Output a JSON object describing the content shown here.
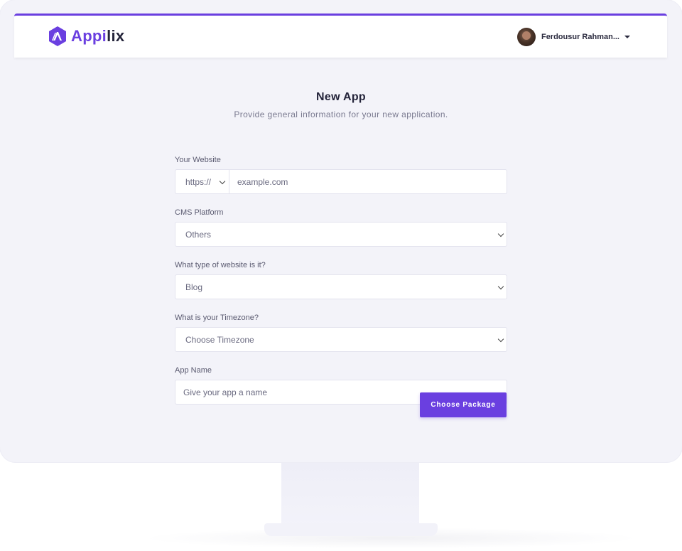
{
  "brand": {
    "name_part1": "Appi",
    "name_part2": "lix",
    "accent_color": "#6a3fe0"
  },
  "user": {
    "name": "Ferdousur Rahman...",
    "avatar_icon": "avatar-photo"
  },
  "page": {
    "title": "New App",
    "subtitle": "Provide general information for your new application."
  },
  "form": {
    "website": {
      "label": "Your Website",
      "protocol_value": "https://",
      "url_placeholder": "example.com"
    },
    "cms": {
      "label": "CMS Platform",
      "selected": "Others"
    },
    "site_type": {
      "label": "What type of website is it?",
      "selected": "Blog"
    },
    "timezone": {
      "label": "What is your Timezone?",
      "selected": "Choose Timezone"
    },
    "app_name": {
      "label": "App Name",
      "placeholder": "Give your app a name"
    },
    "submit_label": "Choose Package"
  }
}
